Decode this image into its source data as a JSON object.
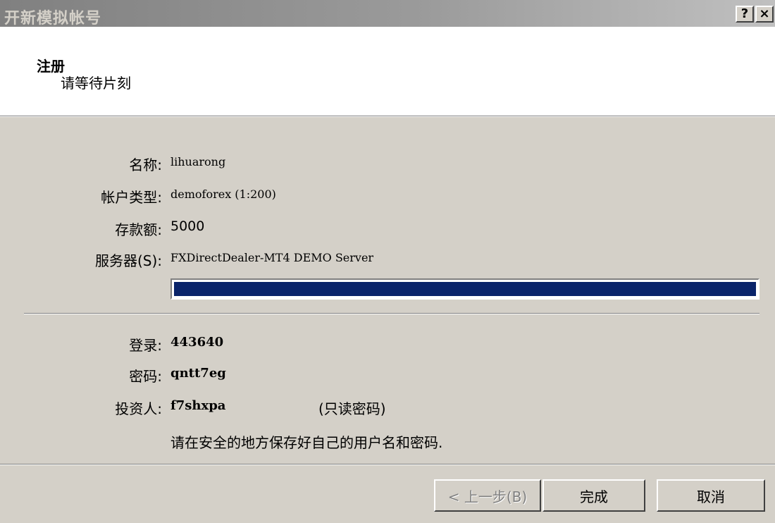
{
  "window": {
    "title": "开新模拟帐号",
    "help_label": "?",
    "close_label": "×"
  },
  "header": {
    "title": "注册",
    "subtitle": "请等待片刻"
  },
  "fields": {
    "name_label": "名称:",
    "name_value": "lihuarong",
    "account_type_label": "帐户类型:",
    "account_type_value": "demoforex (1:200)",
    "deposit_label": "存款额:",
    "deposit_value": "5000",
    "server_label": "服务器(S):",
    "server_value": "FXDirectDealer-MT4 DEMO Server"
  },
  "progress": {
    "percent": 100
  },
  "credentials": {
    "login_label": "登录:",
    "login_value": "443640",
    "password_label": "密码:",
    "password_value": "qntt7eg",
    "investor_label": "投资人:",
    "investor_value": "f7shxpa",
    "investor_note": "(只读密码)",
    "save_note": "请在安全的地方保存好自己的用户名和密码."
  },
  "buttons": {
    "back_label": "< 上一步(B)",
    "finish_label": "完成",
    "cancel_label": "取消"
  }
}
